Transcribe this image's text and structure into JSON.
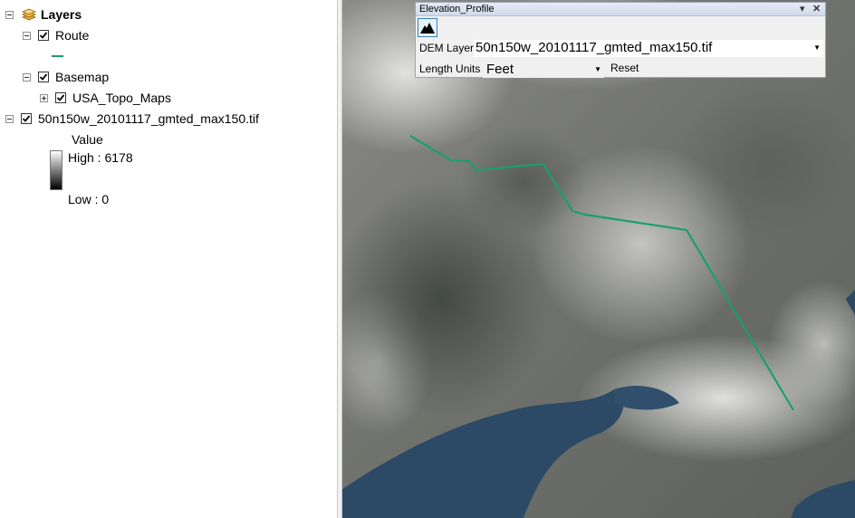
{
  "toc": {
    "root": {
      "label": "Layers",
      "icon": "layers-icon"
    },
    "route": {
      "label": "Route"
    },
    "basemap": {
      "label": "Basemap"
    },
    "topo": {
      "label": "USA_Topo_Maps"
    },
    "dem": {
      "label": "50n150w_20101117_gmted_max150.tif",
      "legend_title": "Value",
      "high": "High : 6178",
      "low": "Low : 0"
    }
  },
  "colors": {
    "route_line": "#1a9e72",
    "water": "#2c4a66",
    "window_title_bg": "#dce4f0"
  },
  "elevation_profile": {
    "title": "Elevation_Profile",
    "pin_icon": "dropdown-arrow-icon",
    "close_icon": "close-icon",
    "tool_icon": "mountain-profile-icon",
    "dem_label": "DEM Layer",
    "dem_value": "50n150w_20101117_gmted_max150.tif",
    "units_label": "Length Units",
    "units_value": "Feet",
    "reset_label": "Reset"
  }
}
